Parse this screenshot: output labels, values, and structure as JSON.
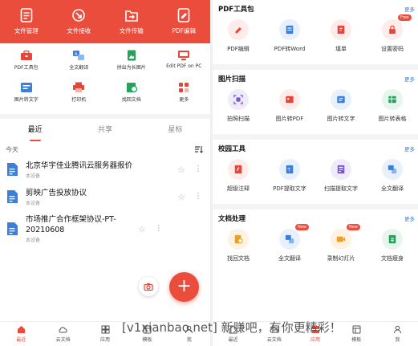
{
  "header": {
    "items": [
      {
        "label": "文件管理",
        "icon": "file-manage-icon"
      },
      {
        "label": "文件接收",
        "icon": "file-receive-icon"
      },
      {
        "label": "文件传输",
        "icon": "file-transfer-icon"
      },
      {
        "label": "PDF编辑",
        "icon": "pdf-edit-icon"
      }
    ],
    "color": "#eb4d3d"
  },
  "tools": [
    {
      "label": "PDF工具包",
      "icon": "toolbox-icon"
    },
    {
      "label": "全文翻译",
      "icon": "translate-icon"
    },
    {
      "label": "拼出为长图片",
      "icon": "long-image-icon"
    },
    {
      "label": "Edit PDF on PC",
      "icon": "pc-edit-icon"
    },
    {
      "label": "图片转文字",
      "icon": "image-to-text-icon"
    },
    {
      "label": "打印机",
      "icon": "printer-icon"
    },
    {
      "label": "找回文档",
      "icon": "recover-doc-icon"
    },
    {
      "label": "更多",
      "icon": "more-grid-icon"
    }
  ],
  "tabs": [
    "最近",
    "共享",
    "星标"
  ],
  "today_label": "今天",
  "files": [
    {
      "title": "北京华宇佳业腾讯云服务器报价",
      "sub": "本设备"
    },
    {
      "title": "剪映广告投放协议",
      "sub": "本设备"
    },
    {
      "title": "市场推广合作框架协议-PT-20210608",
      "sub": "本设备"
    }
  ],
  "bottom_nav": [
    {
      "label": "最近",
      "icon": "home-icon"
    },
    {
      "label": "云文档",
      "icon": "cloud-icon"
    },
    {
      "label": "应用",
      "icon": "apps-icon"
    },
    {
      "label": "模板",
      "icon": "template-icon"
    },
    {
      "label": "我",
      "icon": "profile-icon"
    }
  ],
  "bottom_nav_right": [
    {
      "label": "最近",
      "icon": "home-icon"
    },
    {
      "label": "云文档",
      "icon": "cloud-icon"
    },
    {
      "label": "应用",
      "icon": "apps-icon"
    },
    {
      "label": "模板",
      "icon": "template-icon"
    },
    {
      "label": "我",
      "icon": "profile-icon"
    }
  ],
  "sections": [
    {
      "title": "PDF工具包",
      "more": "更多",
      "items": [
        {
          "label": "PDF编辑",
          "icon": "pdf-edit-icon",
          "bg": "#fdecea",
          "fg": "#e4473a"
        },
        {
          "label": "PDF转Word",
          "icon": "pdf-to-word-icon",
          "bg": "#e8f0fc",
          "fg": "#3b7fdc"
        },
        {
          "label": "填单",
          "icon": "fill-form-icon",
          "bg": "#fdecea",
          "fg": "#e4473a"
        },
        {
          "label": "设置密码",
          "icon": "lock-icon",
          "bg": "#fdecea",
          "fg": "#e4473a",
          "badge": "Free"
        }
      ]
    },
    {
      "title": "图片扫描",
      "more": "更多",
      "items": [
        {
          "label": "拍照扫描",
          "icon": "scan-icon",
          "bg": "#f0ebfb",
          "fg": "#7a55d6"
        },
        {
          "label": "图片转PDF",
          "icon": "image-to-pdf-icon",
          "bg": "#fdecea",
          "fg": "#e4473a"
        },
        {
          "label": "图片转文字",
          "icon": "image-to-text-icon",
          "bg": "#e8f0fc",
          "fg": "#3b7fdc"
        },
        {
          "label": "图片转表格",
          "icon": "image-to-table-icon",
          "bg": "#e6f6ec",
          "fg": "#23a25a"
        }
      ]
    },
    {
      "title": "校园工具",
      "more": "更多",
      "items": [
        {
          "label": "超级注释",
          "icon": "annotate-icon",
          "bg": "#fdecea",
          "fg": "#e4473a"
        },
        {
          "label": "PDF提取文字",
          "icon": "pdf-extract-icon",
          "bg": "#e8f0fc",
          "fg": "#3b7fdc"
        },
        {
          "label": "扫描提取文字",
          "icon": "scan-extract-icon",
          "bg": "#f0ebfb",
          "fg": "#7a55d6"
        },
        {
          "label": "全文翻译",
          "icon": "translate-icon",
          "bg": "#e8f0fc",
          "fg": "#3b7fdc"
        }
      ]
    },
    {
      "title": "文档处理",
      "more": "更多",
      "items": [
        {
          "label": "找回文档",
          "icon": "recover-doc-icon",
          "bg": "#fdf3e0",
          "fg": "#f0a020"
        },
        {
          "label": "全文翻译",
          "icon": "translate-icon",
          "bg": "#e8f0fc",
          "fg": "#3b7fdc",
          "badge": "New"
        },
        {
          "label": "录制幻灯片",
          "icon": "record-slides-icon",
          "bg": "#fdf3e0",
          "fg": "#f0a020",
          "badge": "New"
        },
        {
          "label": "文档瘦身",
          "icon": "slim-doc-icon",
          "bg": "#e6f6ec",
          "fg": "#23a25a"
        }
      ]
    }
  ],
  "watermark": "[v1xianbao.net] 新赚吧，有你更精彩！"
}
